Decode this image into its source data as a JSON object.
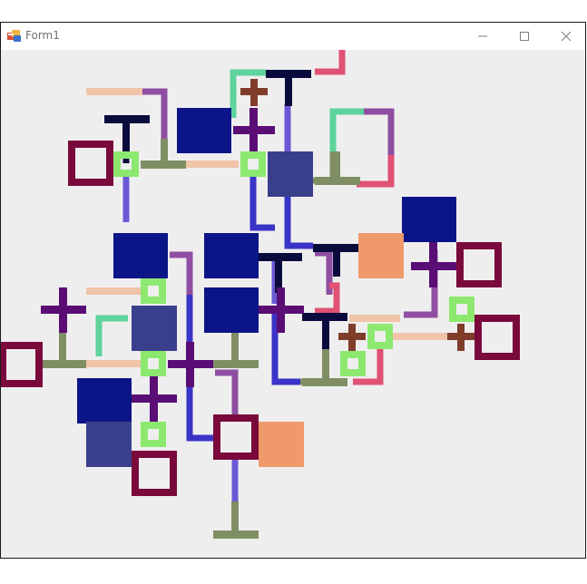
{
  "window": {
    "title": "Form1",
    "icons": {
      "app": "form-app-icon",
      "minimize": "minimize-icon",
      "maximize": "maximize-icon",
      "close": "close-icon"
    }
  },
  "palette": {
    "window_background": "#f0f0f0",
    "navy": "#0b1587",
    "slate_blue": "#3a3f8c",
    "blue_line": "#3a34c8",
    "periwinkle": "#6a59d6",
    "maroon": "#7a0a3b",
    "purple": "#5a0d74",
    "violet": "#8f4ea1",
    "mint": "#5ed39b",
    "light_green": "#8de870",
    "peach": "#f0c4a8",
    "salmon": "#f09a6c",
    "pink": "#e05273",
    "olive": "#7f8f63",
    "dark_navy": "#0a0b3d",
    "brown": "#7f3d2a"
  }
}
